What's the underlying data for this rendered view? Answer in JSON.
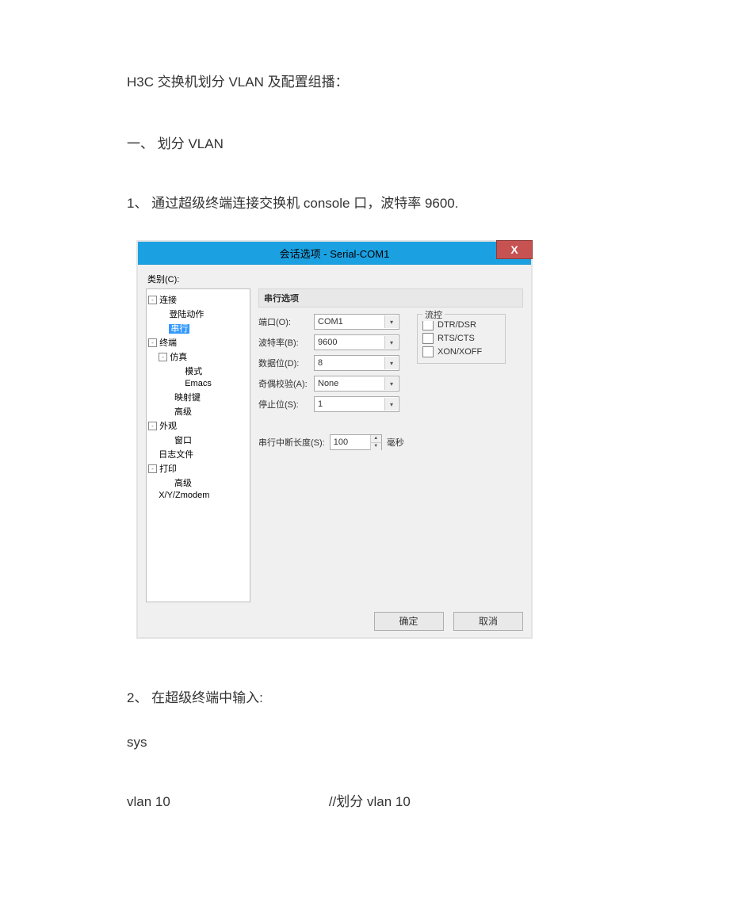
{
  "doc": {
    "title": "H3C 交换机划分 VLAN 及配置组播：",
    "section1": "一、  划分 VLAN",
    "step1": "1、  通过超级终端连接交换机 console 口，波特率 9600.",
    "step2": "2、  在超级终端中输入:",
    "cmd1": "sys",
    "cmd2": "vlan  10",
    "cmd2_comment": "//划分 vlan  10"
  },
  "dialog": {
    "title": "会话选项 - Serial-COM1",
    "close": "X",
    "category_label": "类别(C):",
    "group_title": "串行选项",
    "port_lbl": "端口(O):",
    "port_val": "COM1",
    "baud_lbl": "波特率(B):",
    "baud_val": "9600",
    "data_lbl": "数据位(D):",
    "data_val": "8",
    "parity_lbl": "奇偶校验(A):",
    "parity_val": "None",
    "stop_lbl": "停止位(S):",
    "stop_val": "1",
    "flow_legend": "流控",
    "chk1": "DTR/DSR",
    "chk2": "RTS/CTS",
    "chk3": "XON/XOFF",
    "break_lbl": "串行中断长度(S):",
    "break_val": "100",
    "break_unit": "毫秒",
    "ok": "确定",
    "cancel": "取消",
    "tree": {
      "n0": "连接",
      "n0_0": "登陆动作",
      "n0_1": "串行",
      "n1": "终端",
      "n1_0": "仿真",
      "n1_0_0": "模式",
      "n1_0_1": "Emacs",
      "n1_1": "映射键",
      "n1_2": "高级",
      "n2": "外观",
      "n2_0": "窗口",
      "n3": "日志文件",
      "n4": "打印",
      "n4_0": "高级",
      "n5": "X/Y/Zmodem"
    }
  }
}
